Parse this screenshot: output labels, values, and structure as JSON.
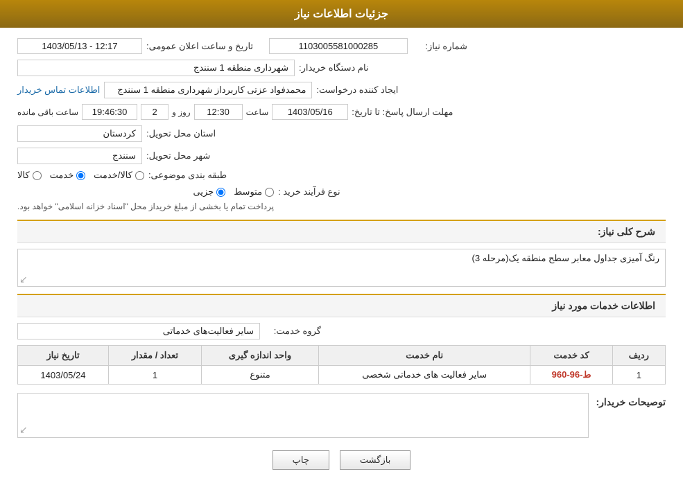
{
  "header": {
    "title": "جزئیات اطلاعات نیاز"
  },
  "fields": {
    "need_number_label": "شماره نیاز:",
    "need_number_value": "1103005581000285",
    "announcement_datetime_label": "تاریخ و ساعت اعلان عمومی:",
    "announcement_datetime_value": "1403/05/13 - 12:17",
    "buyer_org_label": "نام دستگاه خریدار:",
    "buyer_org_value": "شهرداری منطقه 1 سنندج",
    "creator_label": "ایجاد کننده درخواست:",
    "creator_value": "محمدفواد عزتی کاربرداز شهرداری منطقه 1 سنندج",
    "contact_link": "اطلاعات تماس خریدار",
    "deadline_label": "مهلت ارسال پاسخ: تا تاریخ:",
    "deadline_date": "1403/05/16",
    "deadline_time_label": "ساعت",
    "deadline_time": "12:30",
    "deadline_day_label": "روز و",
    "deadline_days": "2",
    "deadline_remaining_label": "ساعت باقی مانده",
    "deadline_remaining_time": "19:46:30",
    "province_label": "استان محل تحویل:",
    "province_value": "کردستان",
    "city_label": "شهر محل تحویل:",
    "city_value": "سنندج",
    "category_label": "طبقه بندی موضوعی:",
    "category_kala": "کالا",
    "category_khadamat": "خدمت",
    "category_kala_khadamat": "کالا/خدمت",
    "category_selected": "khadamat",
    "purchase_type_label": "نوع فرآیند خرید :",
    "purchase_jozvi": "جزیی",
    "purchase_motavaset": "متوسط",
    "purchase_selected": "jozvi",
    "purchase_description": "پرداخت تمام یا بخشی از مبلغ خریداز محل \"اسناد خزانه اسلامی\" خواهد بود.",
    "need_description_label": "شرح کلی نیاز:",
    "need_description_value": "رنگ آمیزی جداول معابر سطح منطقه یک(مرحله 3)",
    "service_info_label": "اطلاعات خدمات مورد نیاز",
    "service_group_label": "گروه خدمت:",
    "service_group_value": "سایر فعالیت‌های خدماتی"
  },
  "table": {
    "headers": [
      "ردیف",
      "کد خدمت",
      "نام خدمت",
      "واحد اندازه گیری",
      "تعداد / مقدار",
      "تاریخ نیاز"
    ],
    "rows": [
      {
        "row": "1",
        "code": "ط-96-960",
        "name": "سایر فعالیت های خدماتی شخصی",
        "unit": "متنوع",
        "quantity": "1",
        "date": "1403/05/24"
      }
    ]
  },
  "buyer_notes": {
    "label": "توصیحات خریدار:",
    "value": ""
  },
  "buttons": {
    "print": "چاپ",
    "back": "بازگشت"
  }
}
